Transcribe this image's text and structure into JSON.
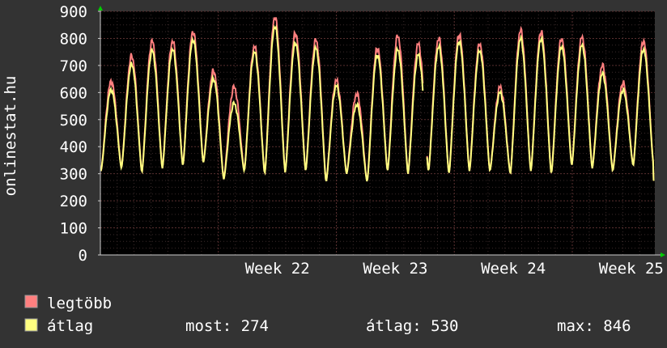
{
  "chart_data": {
    "type": "line",
    "ylabel": "onlinestat.hu",
    "ylim": [
      0,
      900
    ],
    "y_ticks": [
      0,
      100,
      200,
      300,
      400,
      500,
      600,
      700,
      800,
      900
    ],
    "y_tick_labels": [
      "0",
      "100",
      "200",
      "300",
      "400",
      "500",
      "600",
      "700",
      "800",
      "900"
    ],
    "x_range_weeks": [
      21.0,
      25.7
    ],
    "x_week_ticks": [
      22,
      23,
      24,
      25
    ],
    "x_tick_labels": [
      "Week 22",
      "Week 23",
      "Week 24",
      "Week 25"
    ],
    "grid": true,
    "colors": {
      "background": "#333333",
      "plot_background": "#000000",
      "grid_minor": "#3a2a2a",
      "grid_major": "#5a3030",
      "axis": "#cccccc",
      "arrow": "#00cc00",
      "max_series": "#ff7f7f",
      "avg_series": "#ffff80"
    },
    "daily_peaks_max": [
      640,
      735,
      790,
      790,
      825,
      680,
      620,
      770,
      880,
      820,
      795,
      645,
      595,
      765,
      810,
      780,
      800,
      815,
      780,
      620,
      830,
      825,
      800,
      805,
      700,
      635,
      790
    ],
    "daily_peaks_avg": [
      610,
      705,
      755,
      760,
      795,
      650,
      560,
      750,
      845,
      785,
      765,
      625,
      555,
      740,
      760,
      740,
      770,
      790,
      755,
      600,
      800,
      800,
      770,
      775,
      670,
      610,
      760
    ],
    "daily_troughs": [
      310,
      320,
      305,
      320,
      330,
      340,
      280,
      310,
      300,
      305,
      310,
      270,
      300,
      270,
      310,
      300,
      310,
      300,
      310,
      310,
      300,
      310,
      300,
      330,
      320,
      310,
      330
    ],
    "series": [
      {
        "name": "legtöbb",
        "color": "#ff7f7f"
      },
      {
        "name": "átlag",
        "color": "#ffff80"
      }
    ],
    "gap_week": 23.75,
    "last_value": 274
  },
  "legend": {
    "max_label": "legtöbb",
    "avg_label": "átlag",
    "most": "most: 274",
    "avg": "átlag: 530",
    "max": "max: 846"
  }
}
